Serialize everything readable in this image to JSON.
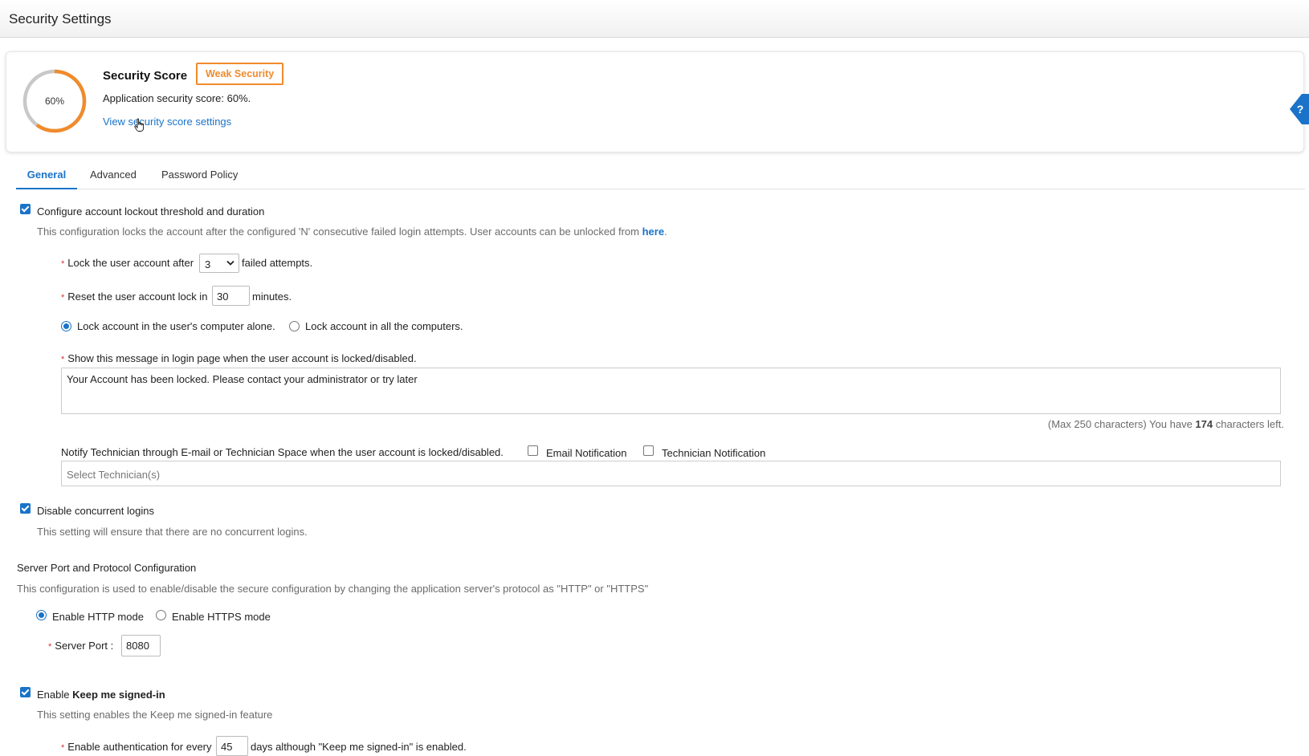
{
  "header": {
    "title": "Security Settings"
  },
  "score": {
    "percent": 60,
    "percent_label": "60%",
    "title": "Security Score",
    "badge": "Weak Security",
    "description": "Application security score: 60%.",
    "link": "View security score settings",
    "colors": {
      "progress": "#f08b2c",
      "track": "#c8c8c8",
      "accent": "#1a73c8"
    }
  },
  "tabs": [
    {
      "label": "General",
      "active": true
    },
    {
      "label": "Advanced",
      "active": false
    },
    {
      "label": "Password Policy",
      "active": false
    }
  ],
  "lockout": {
    "checked": true,
    "label": "Configure account lockout threshold and duration",
    "description_prefix": "This configuration locks the account after the configured 'N' consecutive failed login attempts. User accounts can be unlocked from ",
    "description_link": "here",
    "description_suffix": ".",
    "lock_after_label": "Lock the user account after",
    "lock_after_value": "3",
    "lock_after_suffix": "failed attempts.",
    "reset_label": "Reset the user account lock in",
    "reset_value": "30",
    "reset_suffix": "minutes.",
    "radio_alone": "Lock account in the user's computer alone.",
    "radio_all": "Lock account in all the computers.",
    "message_label": "Show this message in login page when the user account is locked/disabled.",
    "message_value": "Your Account has been locked. Please contact your administrator or try later",
    "chars_prefix": "(Max 250 characters) You have ",
    "chars_left": "174",
    "chars_suffix": " characters left.",
    "notify_label": "Notify Technician through E-mail or Technician Space when the user account is locked/disabled.",
    "email_notification": "Email Notification",
    "technician_notification": "Technician Notification",
    "technician_placeholder": "Select Technician(s)"
  },
  "concurrent": {
    "checked": true,
    "label": "Disable concurrent logins",
    "description": "This setting will ensure that there are no concurrent logins."
  },
  "server": {
    "title": "Server Port and Protocol Configuration",
    "description": "This configuration is used to enable/disable the secure configuration by changing the application server's protocol as \"HTTP\" or \"HTTPS\"",
    "http_label": "Enable HTTP mode",
    "https_label": "Enable HTTPS mode",
    "port_label": "Server Port :",
    "port_value": "8080"
  },
  "keep_signed": {
    "checked": true,
    "label_prefix": "Enable ",
    "label_bold": "Keep me signed-in",
    "description": "This setting enables the Keep me signed-in feature",
    "auth_label": "Enable authentication for every",
    "auth_value": "45",
    "auth_suffix": "days although \"Keep me signed-in\" is enabled."
  }
}
